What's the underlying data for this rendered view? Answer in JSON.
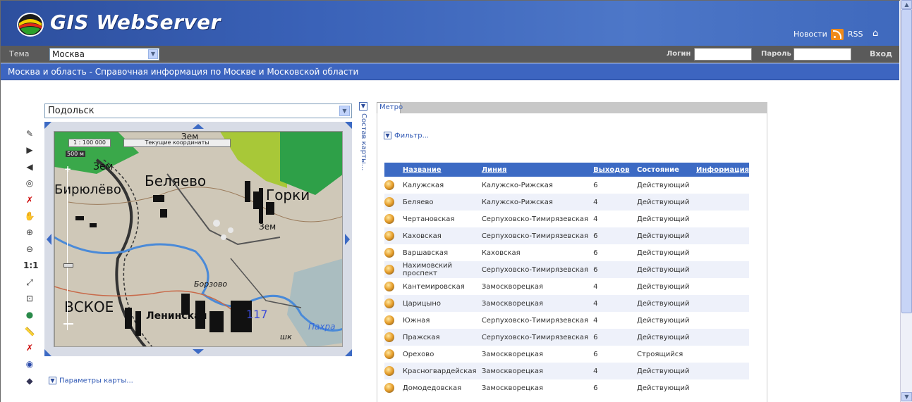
{
  "header": {
    "brand": "GIS WebServer",
    "news_label": "Новости",
    "rss_label": "RSS",
    "home_icon": "home-icon"
  },
  "theme_bar": {
    "theme_label": "Тема",
    "theme_value": "Москва",
    "login_label": "Логин",
    "password_label": "Пароль",
    "enter_label": "Вход"
  },
  "subtitle": "Москва и область - Справочная информация по Москве и Московской области",
  "map_panel": {
    "region_value": "Подольск",
    "scale": "1 : 100 000",
    "coords_label": "Текущие координаты",
    "scale_bar": "500 м",
    "map_labels": [
      "Зем",
      "Беляево",
      "Горки",
      "Бирюлёво",
      "Зем",
      "Зем",
      "Борзово",
      "ВСКОЕ",
      "Ленинская",
      "117",
      "Пахра",
      "шк"
    ],
    "side_label": "Состав карты...",
    "params_label": "Параметры карты...",
    "tools": [
      "select-tool-icon",
      "forward-icon",
      "back-icon",
      "info-icon",
      "clear-select-icon",
      "pan-icon",
      "zoom-in-icon",
      "zoom-out-icon",
      "one-to-one-icon",
      "zoom-extent-icon",
      "zoom-selection-icon",
      "globe-icon",
      "measure-icon",
      "clear-measure-icon",
      "layers-icon",
      "print-icon"
    ]
  },
  "right_panel": {
    "tab": "Метро",
    "filter_label": "Фильтр...",
    "columns": [
      "Название",
      "Линия",
      "Выходов",
      "Состояние",
      "Информация"
    ],
    "rows": [
      [
        "Калужская",
        "Калужско-Рижская",
        "6",
        "Действующий"
      ],
      [
        "Беляево",
        "Калужско-Рижская",
        "4",
        "Действующий"
      ],
      [
        "Чертановская",
        "Серпуховско-Тимирязевская",
        "4",
        "Действующий"
      ],
      [
        "Каховская",
        "Серпуховско-Тимирязевская",
        "6",
        "Действующий"
      ],
      [
        "Варшавская",
        "Каховская",
        "6",
        "Действующий"
      ],
      [
        "Нахимовский проспект",
        "Серпуховско-Тимирязевская",
        "6",
        "Действующий"
      ],
      [
        "Кантемировская",
        "Замоскворецкая",
        "4",
        "Действующий"
      ],
      [
        "Царицыно",
        "Замоскворецкая",
        "4",
        "Действующий"
      ],
      [
        "Южная",
        "Серпуховско-Тимирязевская",
        "4",
        "Действующий"
      ],
      [
        "Пражская",
        "Серпуховско-Тимирязевская",
        "6",
        "Действующий"
      ],
      [
        "Орехово",
        "Замоскворецкая",
        "6",
        "Строящийся"
      ],
      [
        "Красногвардейская",
        "Замоскворецкая",
        "4",
        "Действующий"
      ],
      [
        "Домодедовская",
        "Замоскворецкая",
        "6",
        "Действующий"
      ]
    ]
  }
}
